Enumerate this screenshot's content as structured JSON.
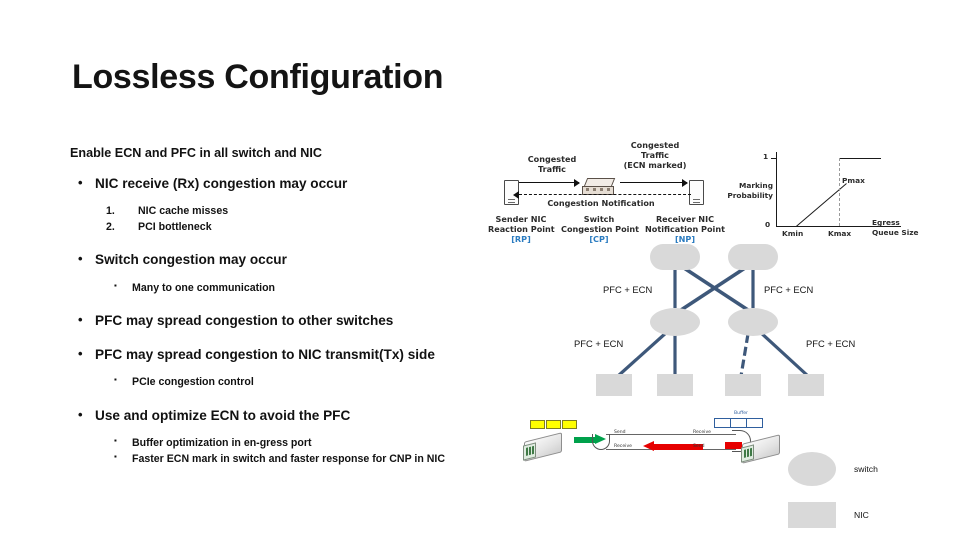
{
  "slide": {
    "title": "Lossless Configuration",
    "lead": "Enable ECN and PFC in all switch and NIC",
    "bullets": [
      {
        "level": 1,
        "text": "NIC receive (Rx) congestion may occur"
      },
      {
        "level": "num",
        "num": "1.",
        "text": "NIC cache misses"
      },
      {
        "level": "num",
        "num": "2.",
        "text": "PCI bottleneck"
      },
      {
        "level": 1,
        "text": "Switch congestion may occur"
      },
      {
        "level": 2,
        "text": "Many to one communication"
      },
      {
        "level": 1,
        "text": "PFC may spread congestion to other switches"
      },
      {
        "level": 1,
        "text": "PFC may spread congestion to NIC transmit(Tx) side"
      },
      {
        "level": 2,
        "text": "PCIe congestion control"
      },
      {
        "level": 1,
        "text": "Use and optimize ECN to avoid the PFC"
      },
      {
        "level": 2,
        "text": "Buffer optimization in en-gress port"
      },
      {
        "level": 2,
        "text": "Faster ECN mark in switch and faster response for CNP in NIC"
      }
    ]
  },
  "dcqcn": {
    "congested_traffic_left": "Congested\nTraffic",
    "congested_traffic_left_l1": "Congested",
    "congested_traffic_left_l2": "Traffic",
    "congested_traffic_right_l1": "Congested",
    "congested_traffic_right_l2": "Traffic",
    "congested_traffic_right_l3": "(ECN marked)",
    "congestion_notification": "Congestion Notification",
    "sender_l1": "Sender NIC",
    "sender_l2": "Reaction Point",
    "sender_tag": "[RP]",
    "switch_l1": "Switch",
    "switch_l2": "Congestion Point",
    "switch_tag": "[CP]",
    "receiver_l1": "Receiver NIC",
    "receiver_l2": "Notification Point",
    "receiver_tag": "[NP]",
    "tag_color": "#2a7bc0"
  },
  "chart_data": {
    "type": "line",
    "title": "",
    "xlabel": "Egress Queue Size",
    "xlabel_l1": "Egress",
    "xlabel_l2": "Queue Size",
    "ylabel": "Marking Probability",
    "ylabel_l1": "Marking",
    "ylabel_l2": "Probability",
    "xtick_labels": [
      "Kmin",
      "Kmax"
    ],
    "ytick_labels": [
      "0",
      "1"
    ],
    "annotations": [
      "Pmax"
    ],
    "x": [
      "0",
      "Kmin",
      "Kmax",
      "Kmax",
      "max"
    ],
    "y": [
      0,
      0,
      "Pmax",
      1,
      1
    ],
    "ylim": [
      0,
      1
    ],
    "grid": false,
    "legend": "none",
    "description": "ECN marking probability rises linearly from 0 at Kmin to Pmax at Kmax, then jumps to 1 beyond Kmax."
  },
  "topology": {
    "link_color": "#3e587a",
    "node_color": "#d9d9d9",
    "labels": [
      {
        "text": "PFC + ECN",
        "pos": "upper-left"
      },
      {
        "text": "PFC + ECN",
        "pos": "upper-right"
      },
      {
        "text": "PFC + ECN",
        "pos": "lower-left"
      },
      {
        "text": "PFC + ECN",
        "pos": "lower-right"
      }
    ],
    "spine_count": 2,
    "leaf_count": 2,
    "nic_count": 4
  },
  "pfc_diagram": {
    "send_label": "Send",
    "receive_label": "Receive",
    "receive_label_right": "Receive",
    "send_label_right": "Send",
    "buffer_label": "Buffer",
    "queue_color": "#ffff00",
    "data_arrow_color": "#00a14b",
    "pause_arrow_color": "#e60000"
  },
  "legend": {
    "switch_label": "switch",
    "nic_label": "NIC"
  }
}
